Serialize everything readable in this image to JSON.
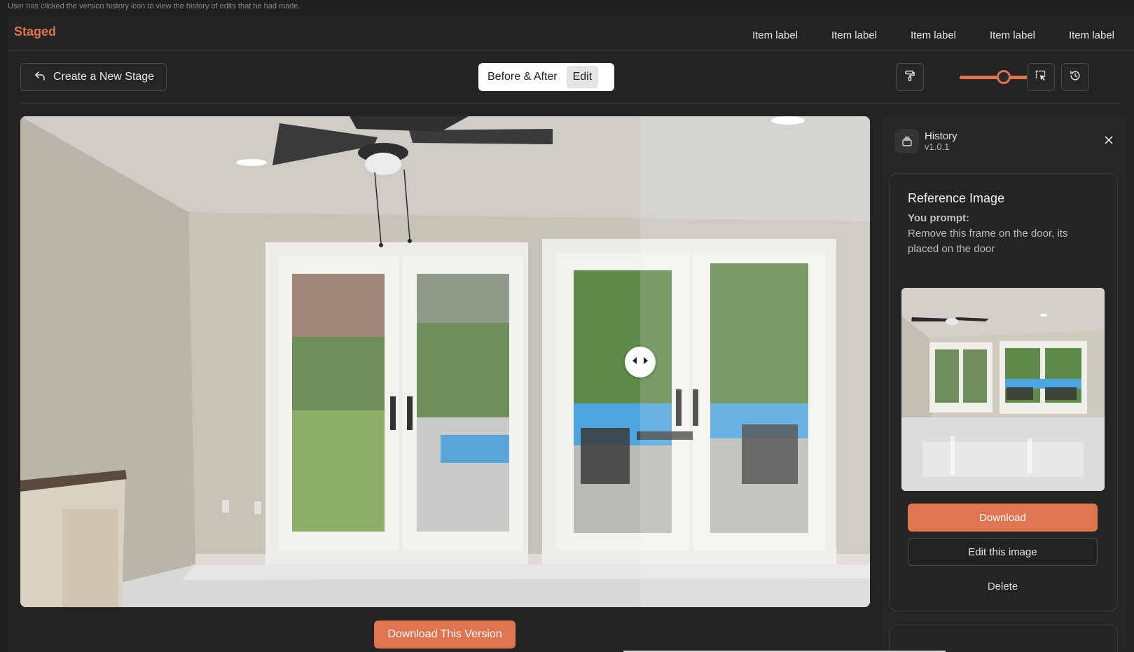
{
  "caption": "User has clicked the version history icon to view the history of edits that he had made.",
  "brand": "Staged",
  "nav": [
    "Item label",
    "Item label",
    "Item label",
    "Item label",
    "Item label"
  ],
  "toolbar": {
    "create_stage_label": "Create a New Stage",
    "view_toggle": {
      "options": [
        "Before & After",
        "Edit"
      ],
      "selected": "Edit"
    },
    "brush_size_fraction": 0.5,
    "icons": [
      "undo-arrow-icon",
      "paint-roller-icon",
      "select-area-icon",
      "history-icon"
    ]
  },
  "viewer": {
    "compare_split_fraction": 0.73,
    "download_label": "Download This Version"
  },
  "history_panel": {
    "title": "History",
    "version": "v1.0.1",
    "item": {
      "title": "Reference Image",
      "prompt_label": "You prompt:",
      "prompt_text": "Remove this frame on the door, its placed on the door",
      "download_label": "Download",
      "edit_label": "Edit this image",
      "delete_label": "Delete"
    }
  },
  "colors": {
    "accent": "#e0744f",
    "background": "#1f1f1f",
    "panel": "#262626"
  }
}
